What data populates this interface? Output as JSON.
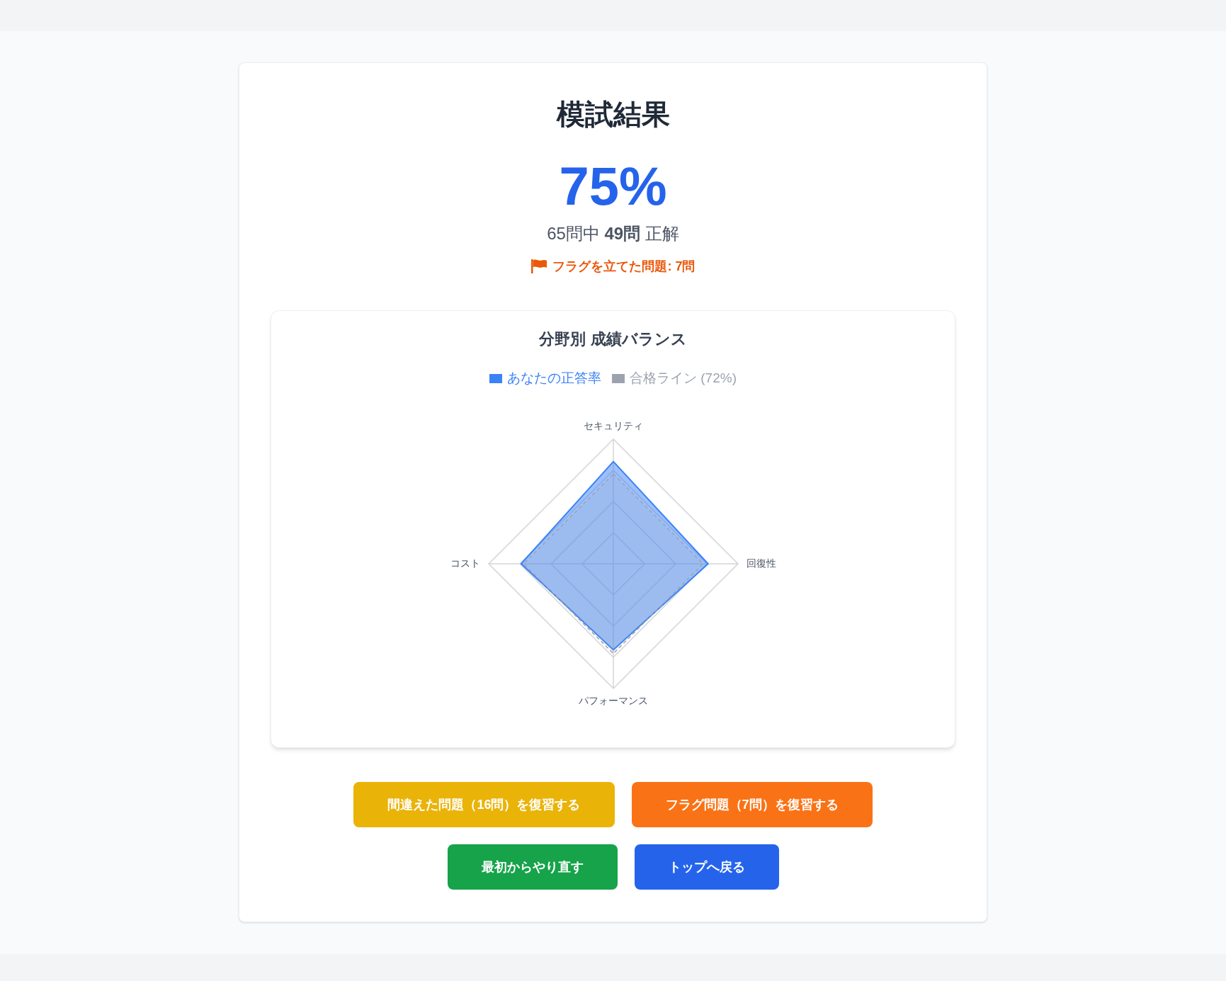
{
  "title": "模試結果",
  "score": {
    "percent": "75%",
    "summary": "65問中 **49問** 正解",
    "flagged": "フラグを立てた問題: 7問"
  },
  "chart_panel": {
    "title": "分野別 成績バランス",
    "legend": [
      {
        "label": "あなたの正答率",
        "color": "#3b82f6"
      },
      {
        "label": "合格ライン (72%)",
        "color": "#9ca3af"
      }
    ],
    "axes": [
      "セキュリティ",
      "回復性",
      "パフォーマンス",
      "コスト"
    ]
  },
  "buttons": [
    {
      "label": "間違えた問題（16問）を復習する",
      "color": "#eab308"
    },
    {
      "label": "フラグ問題（7問）を復習する",
      "color": "#f97316"
    },
    {
      "label": "最初からやり直す",
      "color": "#16a34a"
    },
    {
      "label": "トップへ戻る",
      "color": "#2563eb"
    }
  ]
}
